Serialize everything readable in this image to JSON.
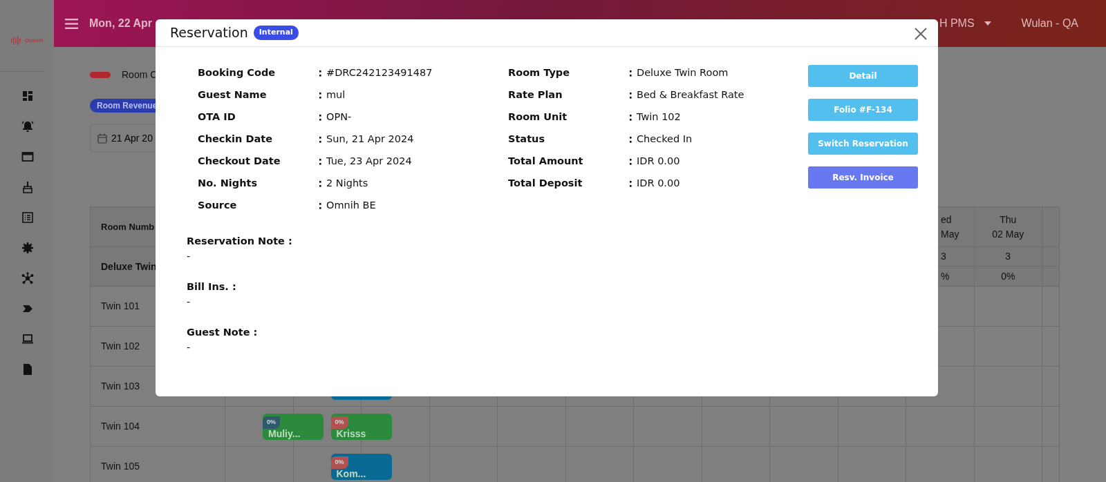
{
  "sidebar": {
    "logo": "OmniH"
  },
  "header": {
    "date": "Mon, 22 Apr",
    "property": "H PMS",
    "user": "Wulan - QA"
  },
  "legend": {
    "label": "Room C"
  },
  "revenue_badge": "Room Revenue",
  "date_filter": {
    "value": "21 Apr 20"
  },
  "grid": {
    "corner": "Room Numb",
    "room_type": "Deluxe Twin",
    "columns": [
      {
        "day": "ed",
        "date": "May",
        "count": "3",
        "occupancy": "%",
        "cut": true
      },
      {
        "day": "Thu",
        "date": "02 May",
        "count": "3",
        "occupancy": "0%",
        "cut": false
      }
    ],
    "rooms": [
      {
        "name": "Twin 101"
      },
      {
        "name": "Twin 102"
      },
      {
        "name": "Twin 103",
        "bookings": [
          {
            "kind": "later",
            "color": "#0b6a94"
          }
        ]
      },
      {
        "name": "Twin 104",
        "bookings": [
          {
            "kind": "earlier",
            "color": "#2b8a3b",
            "label": "Muliy...",
            "tag": {
              "text": "0%",
              "color": "#2f5a6c"
            }
          },
          {
            "kind": "later",
            "color": "#2b8a3b",
            "label": "Krisss",
            "tag": {
              "text": "0%",
              "color": "#b25250"
            }
          }
        ]
      },
      {
        "name": "Twin 105",
        "bookings": [
          {
            "kind": "later",
            "color": "#0b6a94",
            "label": "Kom...",
            "tag": {
              "text": "0%",
              "color": "#b25250"
            }
          }
        ]
      }
    ]
  },
  "modal": {
    "title": "Reservation",
    "badge": "Internal",
    "left_fields": [
      {
        "label": "Booking Code",
        "value": "#DRC242123491487"
      },
      {
        "label": "Guest Name",
        "value": "mul"
      },
      {
        "label": "OTA ID",
        "value": "OPN-"
      },
      {
        "label": "Checkin Date",
        "value": "Sun, 21 Apr 2024"
      },
      {
        "label": "Checkout Date",
        "value": "Tue, 23 Apr 2024"
      },
      {
        "label": "No. Nights",
        "value": "2 Nights"
      },
      {
        "label": "Source",
        "value": "Omnih BE"
      }
    ],
    "right_fields": [
      {
        "label": "Room Type",
        "value": "Deluxe Twin Room"
      },
      {
        "label": "Rate Plan",
        "value": "Bed & Breakfast Rate"
      },
      {
        "label": "Room Unit",
        "value": "Twin 102"
      },
      {
        "label": "Status",
        "value": "Checked In"
      },
      {
        "label": "Total Amount",
        "value": "IDR 0.00"
      },
      {
        "label": "Total Deposit",
        "value": "IDR 0.00"
      }
    ],
    "buttons": [
      {
        "label": "Detail",
        "kind": "info"
      },
      {
        "label": "Folio #F-134",
        "kind": "info"
      },
      {
        "label": "Switch Reservation",
        "kind": "info"
      },
      {
        "label": "Resv. Invoice",
        "kind": "primary"
      }
    ],
    "notes": [
      {
        "heading": "Reservation Note :",
        "text": "-"
      },
      {
        "heading": "Bill Ins. :",
        "text": "-"
      },
      {
        "heading": "Guest Note :",
        "text": "-"
      }
    ]
  }
}
